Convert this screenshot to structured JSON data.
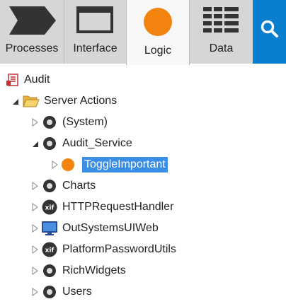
{
  "tabs": {
    "processes": {
      "label": "Processes",
      "icon": "processes-chevron-icon"
    },
    "interface": {
      "label": "Interface",
      "icon": "window-icon"
    },
    "logic": {
      "label": "Logic",
      "icon": "orange-circle-icon",
      "active": true
    },
    "data": {
      "label": "Data",
      "icon": "grid-table-icon"
    },
    "search": {
      "icon": "search-icon"
    }
  },
  "colors": {
    "accent_blue": "#0b7fcf",
    "selection_blue": "#3a8ee6",
    "logic_orange": "#f2830e",
    "tab_bg": "#d6d6d6",
    "active_tab_bg": "#f7f7f7"
  },
  "tree": {
    "root": {
      "label": "Audit",
      "icon": "module-icon"
    },
    "server_actions": {
      "label": "Server Actions",
      "icon": "open-folder-icon",
      "expanded": true
    },
    "items": [
      {
        "label": "(System)",
        "icon": "dark-disc-icon",
        "expanded": false
      },
      {
        "label": "Audit_Service",
        "icon": "dark-disc-icon",
        "expanded": true
      },
      {
        "label": "ToggleImportant",
        "icon": "orange-disc-icon",
        "selected": true
      },
      {
        "label": "Charts",
        "icon": "dark-disc-icon",
        "expanded": false
      },
      {
        "label": "HTTPRequestHandler",
        "icon": "xif-icon",
        "expanded": false
      },
      {
        "label": "OutSystemsUIWeb",
        "icon": "monitor-icon",
        "expanded": false
      },
      {
        "label": "PlatformPasswordUtils",
        "icon": "xif-icon",
        "expanded": false
      },
      {
        "label": "RichWidgets",
        "icon": "dark-disc-icon",
        "expanded": false
      },
      {
        "label": "Users",
        "icon": "dark-disc-icon",
        "expanded": false
      }
    ]
  }
}
